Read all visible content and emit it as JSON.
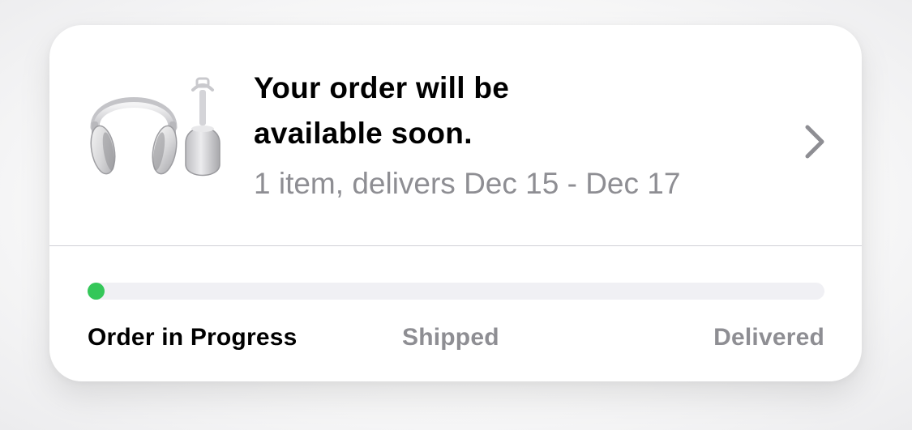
{
  "order_card": {
    "title": "Your order will be available soon.",
    "subtitle": "1 item, delivers Dec 15 - Dec 17",
    "product_image_icon": "airpods-max-headphones",
    "chevron_icon": "chevron-right-icon"
  },
  "progress": {
    "fraction": 0.01,
    "fill_color": "#34c759",
    "track_color": "#f0f0f4",
    "steps": [
      "Order in Progress",
      "Shipped",
      "Delivered"
    ],
    "active_step": 0
  }
}
